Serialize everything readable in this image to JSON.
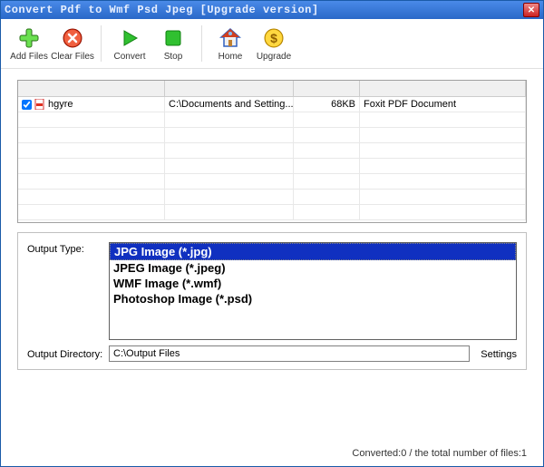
{
  "title": "Convert Pdf to Wmf Psd Jpeg [Upgrade version]",
  "toolbar": {
    "add_files": "Add Files",
    "clear_files": "Clear Files",
    "convert": "Convert",
    "stop": "Stop",
    "home": "Home",
    "upgrade": "Upgrade"
  },
  "grid": {
    "rows": [
      {
        "checked": true,
        "name": "hgyre",
        "path": "C:\\Documents and Setting...",
        "size": "68KB",
        "type": "Foxit PDF Document"
      }
    ]
  },
  "output": {
    "type_label": "Output Type:",
    "types": [
      "JPG Image (*.jpg)",
      "JPEG Image (*.jpeg)",
      "WMF Image (*.wmf)",
      "Photoshop Image (*.psd)"
    ],
    "selected_index": 0,
    "dir_label": "Output Directory:",
    "dir_value": "C:\\Output Files",
    "settings": "Settings"
  },
  "status": "Converted:0  /  the total number of files:1"
}
